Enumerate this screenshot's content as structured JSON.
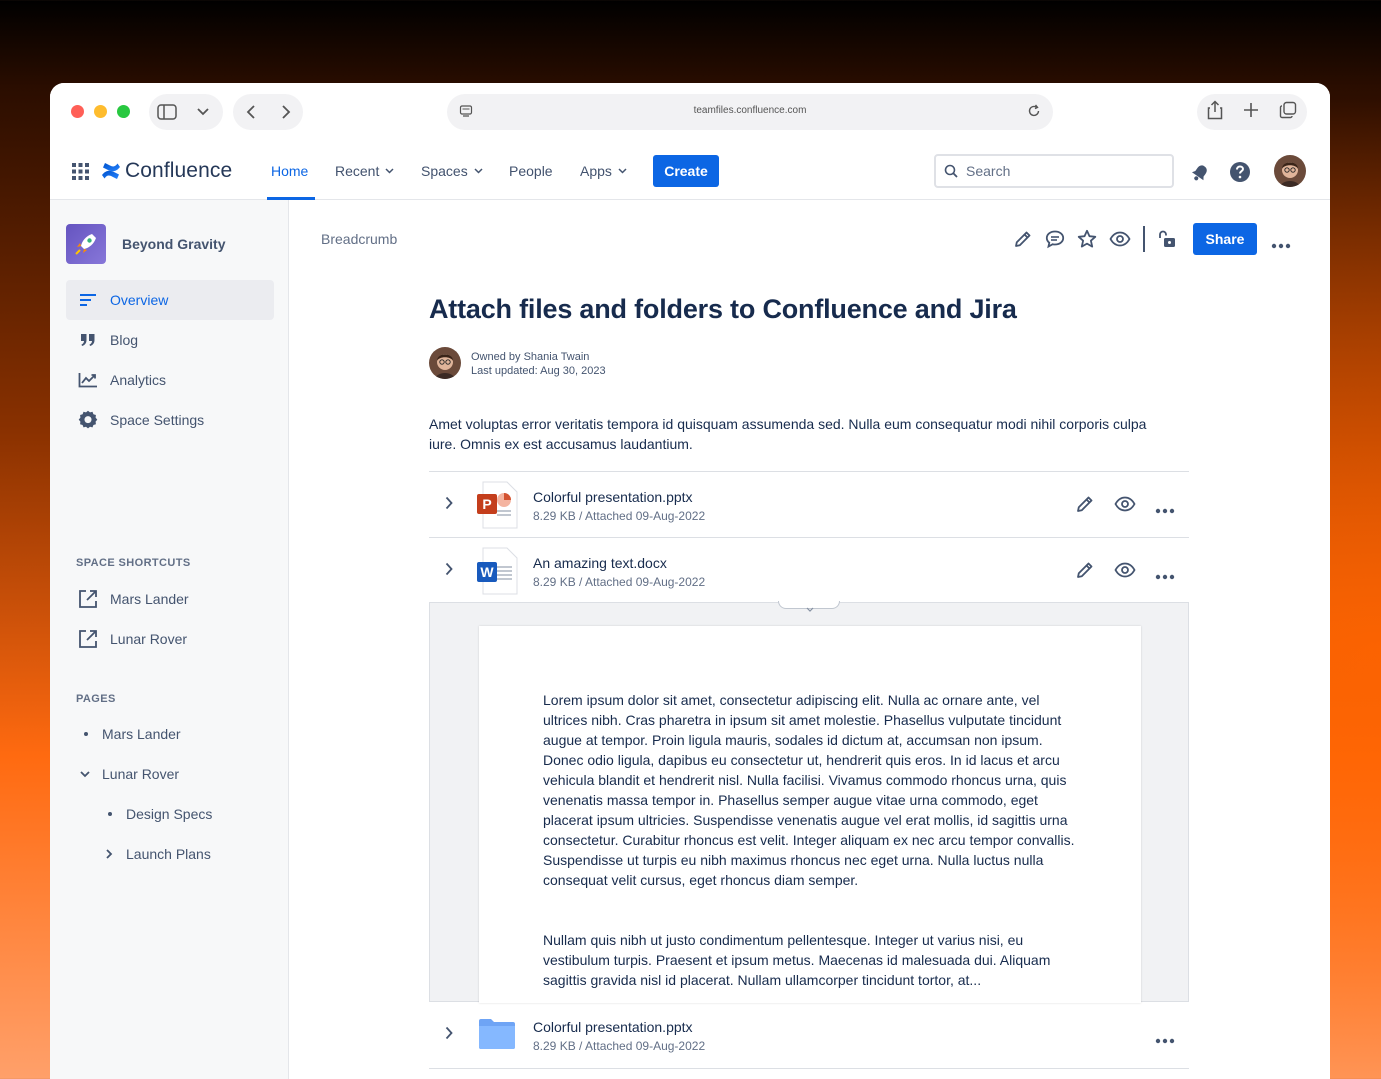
{
  "browser": {
    "url": "teamfiles.confluence.com"
  },
  "nav": {
    "brand": "Confluence",
    "home": "Home",
    "recent": "Recent",
    "spaces": "Spaces",
    "people": "People",
    "apps": "Apps",
    "create": "Create",
    "search_placeholder": "Search"
  },
  "sidebar": {
    "space_name": "Beyond Gravity",
    "items": [
      {
        "label": "Overview",
        "icon": "overview-icon"
      },
      {
        "label": "Blog",
        "icon": "quote-icon"
      },
      {
        "label": "Analytics",
        "icon": "chart-icon"
      },
      {
        "label": "Space Settings",
        "icon": "gear-icon"
      }
    ],
    "shortcuts_heading": "SPACE SHORTCUTS",
    "shortcuts": [
      "Mars Lander",
      "Lunar Rover"
    ],
    "pages_heading": "PAGES",
    "pages": [
      {
        "label": "Mars Lander",
        "level": 0,
        "marker": "bullet"
      },
      {
        "label": "Lunar Rover",
        "level": 0,
        "marker": "expanded"
      },
      {
        "label": "Design Specs",
        "level": 1,
        "marker": "bullet"
      },
      {
        "label": "Launch Plans",
        "level": 1,
        "marker": "collapsed"
      }
    ]
  },
  "page": {
    "breadcrumb": "Breadcrumb",
    "share": "Share",
    "title": "Attach files and folders to Confluence and Jira",
    "owner": "Owned by Shania Twain",
    "updated": "Last updated: Aug 30, 2023",
    "intro": "Amet voluptas error veritatis tempora id quisquam assumenda sed. Nulla eum consequatur modi nihil corporis culpa iure. Omnis ex est accusamus laudantium."
  },
  "attachments": [
    {
      "name": "Colorful presentation.pptx",
      "meta": "8.29 KB / Attached 09-Aug-2022",
      "type": "pptx"
    },
    {
      "name": "An amazing text.docx",
      "meta": "8.29 KB / Attached 09-Aug-2022",
      "type": "docx"
    },
    {
      "name": "Colorful presentation.pptx",
      "meta": "8.29 KB / Attached 09-Aug-2022",
      "type": "folder"
    }
  ],
  "preview": {
    "paragraph1": "Lorem ipsum dolor sit amet, consectetur adipiscing elit. Nulla ac ornare ante, vel ultrices nibh. Cras pharetra in ipsum sit amet molestie. Phasellus vulputate tincidunt augue at tempor. Proin ligula mauris, sodales id dictum at, accumsan non ipsum. Donec odio ligula, dapibus eu consectetur ut, hendrerit quis eros. In id lacus et arcu vehicula blandit et hendrerit nisl. Nulla facilisi. Vivamus commodo rhoncus urna, quis venenatis massa tempor in. Phasellus semper augue vitae urna commodo, eget placerat ipsum ultricies. Suspendisse venenatis augue vel erat mollis, id sagittis urna consectetur. Curabitur rhoncus est velit. Integer aliquam ex nec arcu tempor convallis. Suspendisse ut turpis eu nibh maximus rhoncus nec eget urna. Nulla luctus nulla consequat velit cursus, eget rhoncus diam semper.",
    "paragraph2": "Nullam quis nibh ut justo condimentum pellentesque. Integer ut varius nisi, eu vestibulum turpis. Praesent et ipsum metus. Maecenas id malesuada dui. Aliquam sagittis gravida nisl id placerat. Nullam ullamcorper tincidunt tortor, at..."
  },
  "colors": {
    "primary": "#0c66e4",
    "text": "#172b4d",
    "subtle": "#626f86"
  }
}
